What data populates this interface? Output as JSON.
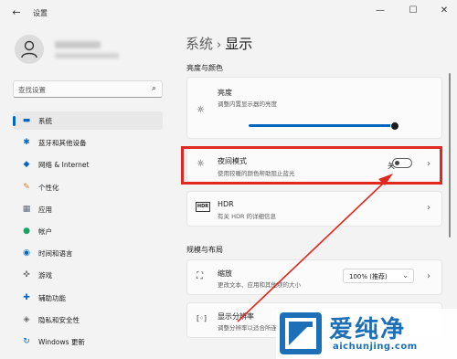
{
  "window": {
    "title": "设置",
    "back_glyph": "←",
    "minimize_glyph": "—",
    "maximize_glyph": "☐",
    "close_glyph": "✕"
  },
  "search": {
    "placeholder": "查找设置",
    "icon": "search-icon"
  },
  "sidebar": {
    "items": [
      {
        "label": "系统",
        "icon": "monitor-icon",
        "glyph": "▬",
        "color": "#0067c0",
        "active": true
      },
      {
        "label": "蓝牙和其他设备",
        "icon": "bluetooth-icon",
        "glyph": "✱",
        "color": "#0067c0"
      },
      {
        "label": "网络 & Internet",
        "icon": "wifi-icon",
        "glyph": "◆",
        "color": "#0067c0"
      },
      {
        "label": "个性化",
        "icon": "brush-icon",
        "glyph": "✎",
        "color": "#d47a1e"
      },
      {
        "label": "应用",
        "icon": "apps-icon",
        "glyph": "▦",
        "color": "#5a6a7a"
      },
      {
        "label": "帐户",
        "icon": "account-icon",
        "glyph": "●",
        "color": "#1aa260"
      },
      {
        "label": "时间和语言",
        "icon": "globe-icon",
        "glyph": "◉",
        "color": "#0067c0"
      },
      {
        "label": "游戏",
        "icon": "gamepad-icon",
        "glyph": "✜",
        "color": "#6a6a6a"
      },
      {
        "label": "辅助功能",
        "icon": "accessibility-icon",
        "glyph": "✚",
        "color": "#0067c0"
      },
      {
        "label": "隐私和安全性",
        "icon": "shield-icon",
        "glyph": "◈",
        "color": "#6a6a6a"
      },
      {
        "label": "Windows 更新",
        "icon": "update-icon",
        "glyph": "↻",
        "color": "#0067c0"
      }
    ]
  },
  "breadcrumb": {
    "parent": "系统",
    "separator": "›",
    "current": "显示"
  },
  "sections": {
    "brightness_color": "亮度与颜色",
    "scale_layout": "规模与布局"
  },
  "brightness": {
    "title": "亮度",
    "desc": "调整内置显示器的亮度",
    "value_percent": 100,
    "icon": "sun-icon",
    "glyph": "☼"
  },
  "night_light": {
    "title": "夜间模式",
    "desc": "使用较暖的颜色帮助阻止蓝光",
    "state_label": "关",
    "on": false,
    "icon": "brightness-icon",
    "glyph": "☼",
    "chevron": "›"
  },
  "hdr": {
    "title": "HDR",
    "desc": "有关 HDR 的详细信息",
    "icon_text": "HDR",
    "chevron": "›"
  },
  "scale": {
    "title": "缩放",
    "desc": "更改文本、应用和其他项的大小",
    "value": "100% (推荐)",
    "icon": "scale-icon",
    "glyph": "⛶",
    "chevron": "›",
    "dropdown_arrow": "⌄"
  },
  "resolution": {
    "title": "显示分辨率",
    "desc": "调整分辨率以适合所连接的显示器",
    "icon": "resolution-icon",
    "glyph": "[◦]"
  },
  "watermark": {
    "text": "爱纯净",
    "url": "aichunjing.com"
  },
  "colors": {
    "accent": "#0067c0",
    "highlight": "#e0281f"
  }
}
